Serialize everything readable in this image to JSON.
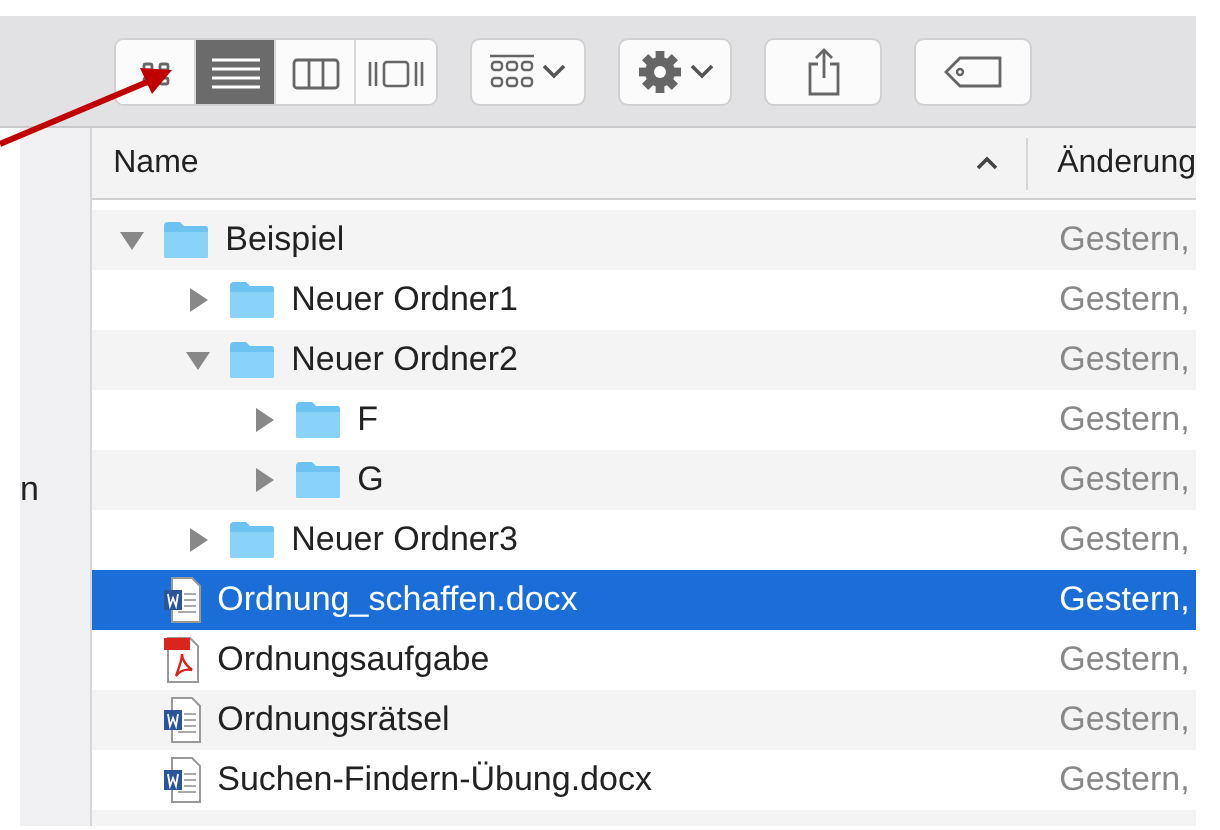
{
  "toolbar": {
    "view_buttons": [
      {
        "kind": "icons",
        "selected": false
      },
      {
        "kind": "list",
        "selected": true
      },
      {
        "kind": "columns",
        "selected": false
      },
      {
        "kind": "coverflow",
        "selected": false
      }
    ],
    "buttons": [
      {
        "kind": "arrange"
      },
      {
        "kind": "action"
      },
      {
        "kind": "share"
      },
      {
        "kind": "tag"
      }
    ]
  },
  "sidebar": {
    "text": "n"
  },
  "columns": [
    {
      "label": "Name",
      "sorted": true
    },
    {
      "label": "Änderung",
      "sorted": false
    }
  ],
  "rows": [
    {
      "kind": "folder",
      "name": "Beispiel",
      "date": "Gestern,",
      "expanded": true,
      "selected": false,
      "children": [
        {
          "kind": "folder",
          "name": "Neuer Ordner1",
          "date": "Gestern,",
          "expanded": false,
          "selected": false
        },
        {
          "kind": "folder",
          "name": "Neuer Ordner2",
          "date": "Gestern,",
          "expanded": true,
          "selected": false,
          "children": [
            {
              "kind": "folder",
              "name": "F",
              "date": "Gestern,",
              "expanded": false,
              "selected": false
            },
            {
              "kind": "folder",
              "name": "G",
              "date": "Gestern,",
              "expanded": false,
              "selected": false
            }
          ]
        },
        {
          "kind": "folder",
          "name": "Neuer Ordner3",
          "date": "Gestern,",
          "expanded": false,
          "selected": false
        }
      ]
    },
    {
      "kind": "word",
      "name": "Ordnung_schaffen.docx",
      "date": "Gestern,",
      "selected": true
    },
    {
      "kind": "pdf",
      "name": "Ordnungsaufgabe",
      "date": "Gestern,",
      "selected": false
    },
    {
      "kind": "word",
      "name": "Ordnungsrätsel",
      "date": "Gestern,",
      "selected": false
    },
    {
      "kind": "word",
      "name": "Suchen-Findern-Übung.docx",
      "date": "Gestern,",
      "selected": false
    }
  ]
}
